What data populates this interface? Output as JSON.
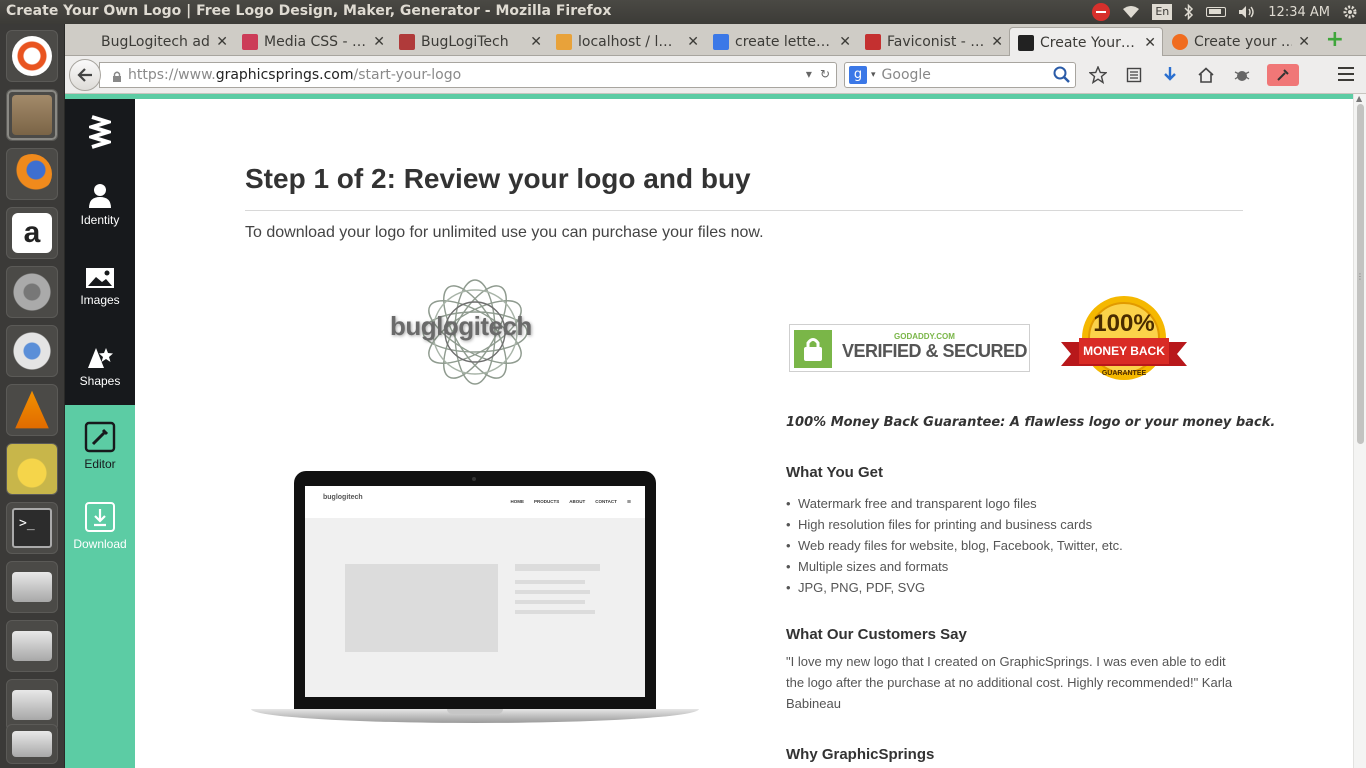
{
  "os": {
    "window_title": "Create Your Own Logo | Free Logo Design, Maker, Generator - Mozilla Firefox",
    "keyboard_layout": "En",
    "clock": "12:34 AM"
  },
  "launcher": {
    "apps": [
      "ubuntu-dash",
      "files",
      "firefox",
      "amazon",
      "system-settings",
      "chromium",
      "vlc",
      "lamp",
      "terminal",
      "drive-1",
      "drive-2",
      "drive-3",
      "drive-4"
    ]
  },
  "browser": {
    "tabs": [
      {
        "label": "BugLogitech ad…",
        "favicon_color": "#cfccc6"
      },
      {
        "label": "Media CSS - …",
        "favicon_color": "#cc3c58"
      },
      {
        "label": "BugLogiTech",
        "favicon_color": "#b03a3a"
      },
      {
        "label": "localhost / l…",
        "favicon_color": "#e8a23a"
      },
      {
        "label": "create lette…",
        "favicon_color": "#3b78e7"
      },
      {
        "label": "Faviconist - …",
        "favicon_color": "#c43030"
      },
      {
        "label": "Create Your…",
        "favicon_color": "#222222"
      },
      {
        "label": "Create your …",
        "favicon_color": "#f06c1f"
      }
    ],
    "url_scheme": "https://www.",
    "url_host": "graphicsprings.com",
    "url_path": "/start-your-logo",
    "search_placeholder": "Google"
  },
  "sidenav": {
    "items": [
      {
        "label": "Identity"
      },
      {
        "label": "Images"
      },
      {
        "label": "Shapes"
      },
      {
        "label": "Editor"
      },
      {
        "label": "Download"
      }
    ]
  },
  "main": {
    "heading": "Step 1 of 2: Review your logo and buy",
    "subtitle": "To download your logo for unlimited use you can purchase your files now.",
    "logo_text": "buglogitech",
    "laptop_brand": "buglogitech",
    "laptop_nav": [
      "HOME",
      "PRODUCTS",
      "ABOUT",
      "CONTACT"
    ],
    "badge_godaddy_small": "GODADDY.COM",
    "badge_godaddy_big": "VERIFIED & SECURED",
    "badge_moneyback_pct": "100%",
    "badge_moneyback_text": "MONEY BACK",
    "badge_moneyback_sub": "GUARANTEE",
    "guarantee_line": "100% Money Back Guarantee: A flawless logo or your money back.",
    "what_you_get_title": "What You Get",
    "what_you_get": [
      "Watermark free and transparent logo files",
      "High resolution files for printing and business cards",
      "Web ready files for website, blog, Facebook, Twitter, etc.",
      "Multiple sizes and formats",
      "JPG, PNG, PDF, SVG"
    ],
    "customers_title": "What Our Customers Say",
    "customer_quote": "\"I love my new logo that I created on GraphicSprings. I was even able to edit the logo after the purchase at no additional cost. Highly recommended!\" Karla Babineau",
    "why_title": "Why GraphicSprings"
  },
  "colors": {
    "accent_teal": "#5ccca4",
    "sidenav_dark": "#17191c"
  }
}
